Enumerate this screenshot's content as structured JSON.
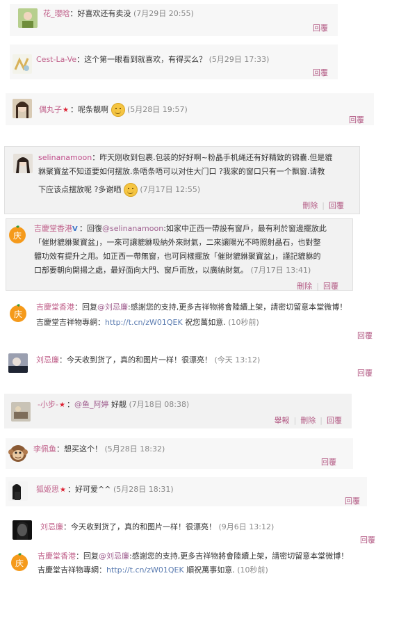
{
  "labels": {
    "reply": "回覆",
    "delete": "刪除",
    "report": "舉報"
  },
  "comments": [
    {
      "user": "花_瓔晗",
      "sep": "：",
      "text": "好喜欢还有卖没",
      "time": "(7月29日 20:55)"
    },
    {
      "user": "Cest-La-Ve",
      "sep": "：",
      "text": "这个第一眼看到就喜欢，有得买么？",
      "time": "(5月29日 17:33)"
    },
    {
      "user": "偶丸子",
      "sep": "：",
      "text": "呢条靓啊",
      "time": "(5月28日 19:57)"
    },
    {
      "user": "selinanamoon",
      "sep": "：",
      "line1": "昨天刚收到包裹.包装的好好啊~粉晶手机绳还有好精致的锦囊.但是貔",
      "line2": "貅聚寶盆不知道要如何摆放.条唔条唔可以对住大门口 ?我家的窗口只有一个飘窗.请教",
      "line3": "下应该点摆放呢 ?多谢晒",
      "time": "(7月17日 12:55)"
    },
    {
      "user": "吉慶堂香港",
      "sep": "：",
      "prefix": "回復",
      "mention": "@selinanamoon",
      "line1": ":如家中正西一帶設有窗戶，最有利於窗邊擺放此",
      "line2": "「催財貔貅聚寶盆」，一來可讓貔貅吸納外來財氣，二來讓陽光不時照射晶石，也對整",
      "line3": "體功效有提升之用。如正西一帶無窗，也可同樣擺放「催財貔貅聚寶盆」，謹記貔貅的",
      "line4": "口部要朝向開揚之處，最好面向大門、窗戶而放，以廣納財氣。",
      "time": "(7月17日 13:41)"
    },
    {
      "user": "吉慶堂香港",
      "sep": "：",
      "prefix": "回复",
      "mention": "@刘忌廉",
      "line1": ":感謝您的支持,更多吉祥物將會陸續上架，請密切留意本堂微博！",
      "line2a": "吉慶堂吉祥物專網：",
      "link": "http://t.cn/zW01QEK",
      "line2b": " 祝您萬如意.",
      "time": "(10秒前)"
    },
    {
      "user": "刘忌廉",
      "sep": "：",
      "text": "今天收到货了，真的和图片一样！很漂亮！",
      "time": "(今天 13:12)"
    },
    {
      "user": "-小步-",
      "sep": "：",
      "mention": "@鱼_阿婷",
      "text": " 好靓",
      "time": "(7月18日 08:38)"
    },
    {
      "user": "李佩鱼",
      "sep": "：",
      "text": "想买这个！",
      "time": "(5月28日 18:32)"
    },
    {
      "user": "狐姬思",
      "sep": "：",
      "text": "好可爱^^",
      "time": "(5月28日 18:31)"
    },
    {
      "user": "刘忌廉",
      "sep": "：",
      "text": "今天收到货了，真的和图片一样！很漂亮！",
      "time": "(9月6日 13:12)"
    },
    {
      "user": "吉慶堂香港",
      "sep": "：",
      "prefix": "回复",
      "mention": "@刘忌廉",
      "line1": ":感謝您的支持,更多吉祥物將會陸續上架，請密切留意本堂微博！",
      "line2a": "吉慶堂吉祥物專網：",
      "link": "http://t.cn/zW01QEK",
      "line2b": " 順祝萬事如意.",
      "time": "(10秒前)"
    }
  ]
}
